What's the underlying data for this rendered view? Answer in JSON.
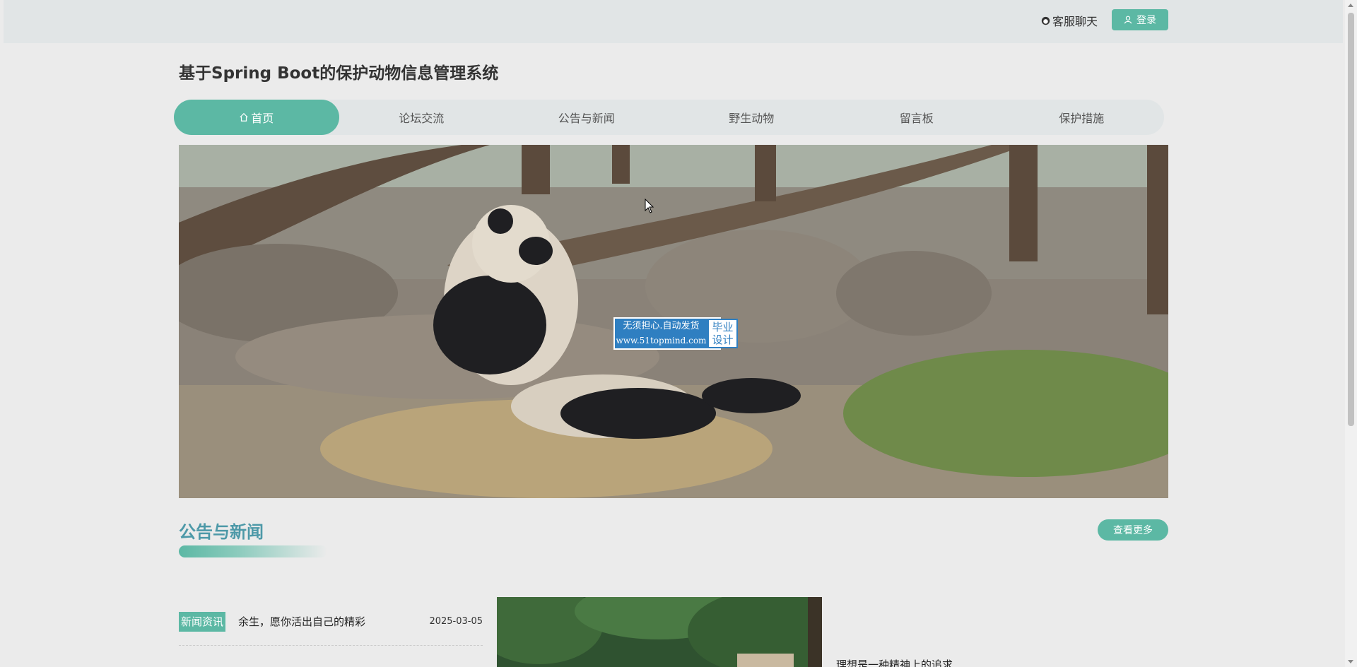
{
  "header": {
    "chat_label": "客服聊天",
    "login_label": "登录"
  },
  "site": {
    "title": "基于Spring Boot的保护动物信息管理系统"
  },
  "nav": {
    "items": [
      {
        "label": "首页",
        "active": true
      },
      {
        "label": "论坛交流"
      },
      {
        "label": "公告与新闻"
      },
      {
        "label": "野生动物"
      },
      {
        "label": "留言板"
      },
      {
        "label": "保护措施"
      }
    ]
  },
  "banner": {
    "watermark_line1": "无须担心.自动发货",
    "watermark_line2": "www.51topmind.com",
    "watermark_side1": "毕业",
    "watermark_side2": "设计"
  },
  "news_section": {
    "title": "公告与新闻",
    "more_label": "查看更多",
    "items": [
      {
        "tag": "新闻资讯",
        "title": "余生，愿你活出自己的精彩",
        "date": "2025-03-05"
      }
    ],
    "feature_text": "理想是一种精神上的追求"
  },
  "colors": {
    "accent": "#5cb8a4",
    "section_title": "#4d99a8",
    "background": "#ebebeb",
    "topbar": "#e1e5e6"
  }
}
